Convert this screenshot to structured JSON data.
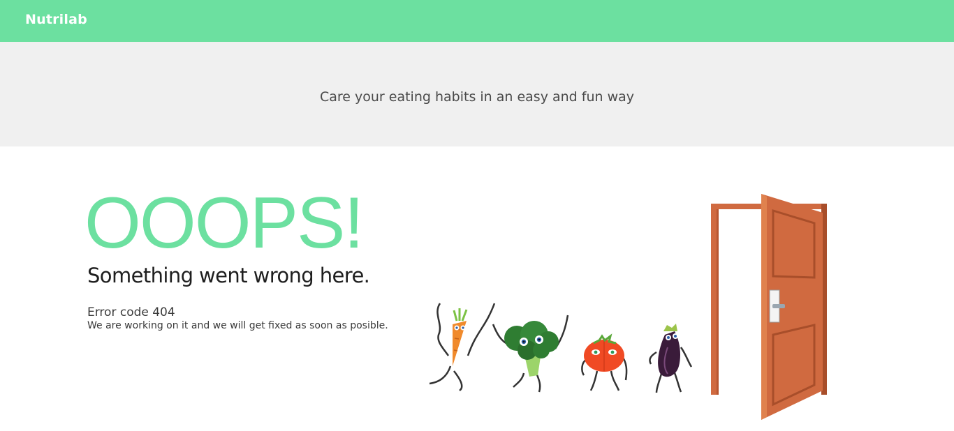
{
  "header": {
    "brand": "Nutrilab"
  },
  "hero": {
    "tagline": "Care your eating habits in an easy and fun way"
  },
  "error": {
    "title": "OOOPS!",
    "headline": "Something went wrong here.",
    "code": "Error code 404",
    "message": "We are working on it and we will get fixed as soon as posible."
  },
  "colors": {
    "accent": "#6ce0a0",
    "band": "#f0f0f0",
    "door": "#d06a40",
    "carrot": "#f08a2c",
    "broccoli": "#2f7d32",
    "tomato": "#f04a24",
    "eggplant": "#3a1b3a"
  },
  "illustration": {
    "characters": [
      "carrot-icon",
      "broccoli-icon",
      "tomato-icon",
      "eggplant-icon"
    ],
    "door": "open-door-icon"
  }
}
